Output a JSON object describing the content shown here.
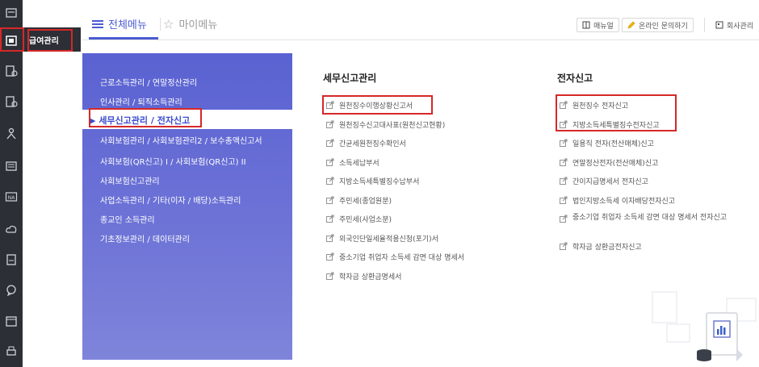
{
  "rail": {
    "icons": [
      "document-icon",
      "payroll-icon",
      "settings-doc-icon",
      "settings-doc-icon-2",
      "person-icon",
      "list-icon",
      "na-icon",
      "cloud-icon",
      "form-icon",
      "chat-icon",
      "calendar-icon",
      "printer-icon"
    ],
    "popup_label": "급여관리"
  },
  "header": {
    "all_menu_label": "전체메뉴",
    "my_menu_label": "마이메뉴",
    "manual_label": "매뉴얼",
    "online_inquiry_label": "온라인 문의하기",
    "company_label": "회사관리"
  },
  "sidebar": {
    "items": [
      "근로소득관리 / 연말정산관리",
      "인사관리 / 퇴직소득관리",
      "세무신고관리 / 전자신고",
      "사회보험관리 / 사회보험관리2 / 보수총액신고서",
      "사회보험(QR신고) I / 사회보험(QR신고) II",
      "사회보험신고관리",
      "사업소득관리 / 기타(이자 / 배당)소득관리",
      "종교인 소득관리",
      "기초정보관리 / 데이터관리"
    ],
    "active_index": 2,
    "active_marker": "▶"
  },
  "tax": {
    "title": "세무신고관리",
    "links": [
      "원천징수이행상황신고서",
      "원천징수신고대사표(원천신고현황)",
      "간균세원천징수확인서",
      "소득세납부서",
      "지방소득세특별징수납부서",
      "주민세(종업원분)",
      "주민세(사업소분)",
      "외국인단일세율적용신청(포기)서",
      "중소기업 취업자 소득세 감면 대상 명세서",
      "학자금 상환금명세서"
    ]
  },
  "efile": {
    "title": "전자신고",
    "links": [
      "원천징수 전자신고",
      "지방소득세특별징수전자신고",
      "일용직 전자(전산매체)신고",
      "연말정산전자(전산매체)신고",
      "간이지급명세서 전자신고",
      "법인지방소득세 이자배당전자신고",
      "중소기업 취업자 소득세 감면 대상 명세서 전자신고",
      "학자금 상환금전자신고"
    ]
  }
}
